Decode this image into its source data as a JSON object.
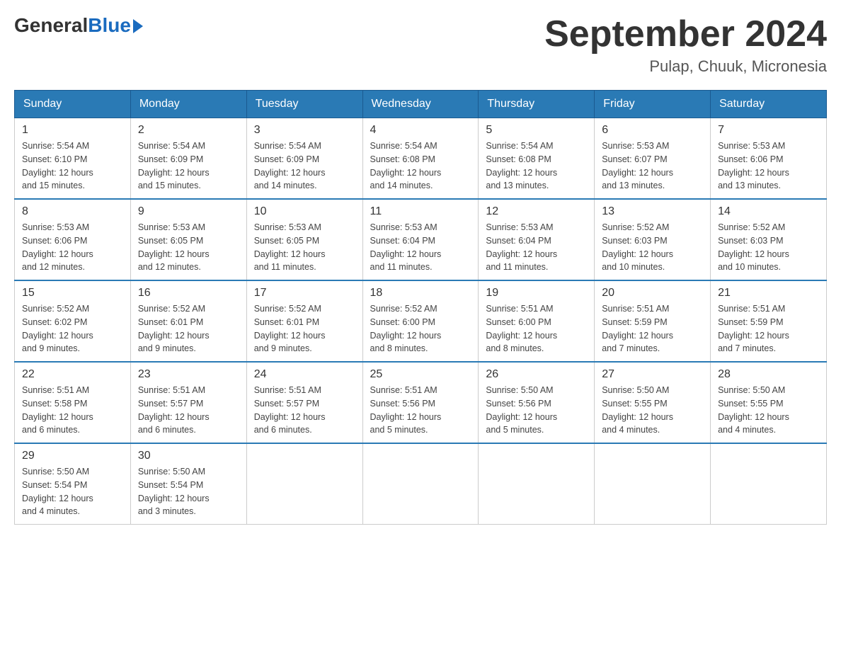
{
  "header": {
    "logo_general": "General",
    "logo_blue": "Blue",
    "month_title": "September 2024",
    "location": "Pulap, Chuuk, Micronesia"
  },
  "weekdays": [
    "Sunday",
    "Monday",
    "Tuesday",
    "Wednesday",
    "Thursday",
    "Friday",
    "Saturday"
  ],
  "weeks": [
    [
      {
        "day": "1",
        "sunrise": "5:54 AM",
        "sunset": "6:10 PM",
        "daylight": "12 hours and 15 minutes."
      },
      {
        "day": "2",
        "sunrise": "5:54 AM",
        "sunset": "6:09 PM",
        "daylight": "12 hours and 15 minutes."
      },
      {
        "day": "3",
        "sunrise": "5:54 AM",
        "sunset": "6:09 PM",
        "daylight": "12 hours and 14 minutes."
      },
      {
        "day": "4",
        "sunrise": "5:54 AM",
        "sunset": "6:08 PM",
        "daylight": "12 hours and 14 minutes."
      },
      {
        "day": "5",
        "sunrise": "5:54 AM",
        "sunset": "6:08 PM",
        "daylight": "12 hours and 13 minutes."
      },
      {
        "day": "6",
        "sunrise": "5:53 AM",
        "sunset": "6:07 PM",
        "daylight": "12 hours and 13 minutes."
      },
      {
        "day": "7",
        "sunrise": "5:53 AM",
        "sunset": "6:06 PM",
        "daylight": "12 hours and 13 minutes."
      }
    ],
    [
      {
        "day": "8",
        "sunrise": "5:53 AM",
        "sunset": "6:06 PM",
        "daylight": "12 hours and 12 minutes."
      },
      {
        "day": "9",
        "sunrise": "5:53 AM",
        "sunset": "6:05 PM",
        "daylight": "12 hours and 12 minutes."
      },
      {
        "day": "10",
        "sunrise": "5:53 AM",
        "sunset": "6:05 PM",
        "daylight": "12 hours and 11 minutes."
      },
      {
        "day": "11",
        "sunrise": "5:53 AM",
        "sunset": "6:04 PM",
        "daylight": "12 hours and 11 minutes."
      },
      {
        "day": "12",
        "sunrise": "5:53 AM",
        "sunset": "6:04 PM",
        "daylight": "12 hours and 11 minutes."
      },
      {
        "day": "13",
        "sunrise": "5:52 AM",
        "sunset": "6:03 PM",
        "daylight": "12 hours and 10 minutes."
      },
      {
        "day": "14",
        "sunrise": "5:52 AM",
        "sunset": "6:03 PM",
        "daylight": "12 hours and 10 minutes."
      }
    ],
    [
      {
        "day": "15",
        "sunrise": "5:52 AM",
        "sunset": "6:02 PM",
        "daylight": "12 hours and 9 minutes."
      },
      {
        "day": "16",
        "sunrise": "5:52 AM",
        "sunset": "6:01 PM",
        "daylight": "12 hours and 9 minutes."
      },
      {
        "day": "17",
        "sunrise": "5:52 AM",
        "sunset": "6:01 PM",
        "daylight": "12 hours and 9 minutes."
      },
      {
        "day": "18",
        "sunrise": "5:52 AM",
        "sunset": "6:00 PM",
        "daylight": "12 hours and 8 minutes."
      },
      {
        "day": "19",
        "sunrise": "5:51 AM",
        "sunset": "6:00 PM",
        "daylight": "12 hours and 8 minutes."
      },
      {
        "day": "20",
        "sunrise": "5:51 AM",
        "sunset": "5:59 PM",
        "daylight": "12 hours and 7 minutes."
      },
      {
        "day": "21",
        "sunrise": "5:51 AM",
        "sunset": "5:59 PM",
        "daylight": "12 hours and 7 minutes."
      }
    ],
    [
      {
        "day": "22",
        "sunrise": "5:51 AM",
        "sunset": "5:58 PM",
        "daylight": "12 hours and 6 minutes."
      },
      {
        "day": "23",
        "sunrise": "5:51 AM",
        "sunset": "5:57 PM",
        "daylight": "12 hours and 6 minutes."
      },
      {
        "day": "24",
        "sunrise": "5:51 AM",
        "sunset": "5:57 PM",
        "daylight": "12 hours and 6 minutes."
      },
      {
        "day": "25",
        "sunrise": "5:51 AM",
        "sunset": "5:56 PM",
        "daylight": "12 hours and 5 minutes."
      },
      {
        "day": "26",
        "sunrise": "5:50 AM",
        "sunset": "5:56 PM",
        "daylight": "12 hours and 5 minutes."
      },
      {
        "day": "27",
        "sunrise": "5:50 AM",
        "sunset": "5:55 PM",
        "daylight": "12 hours and 4 minutes."
      },
      {
        "day": "28",
        "sunrise": "5:50 AM",
        "sunset": "5:55 PM",
        "daylight": "12 hours and 4 minutes."
      }
    ],
    [
      {
        "day": "29",
        "sunrise": "5:50 AM",
        "sunset": "5:54 PM",
        "daylight": "12 hours and 4 minutes."
      },
      {
        "day": "30",
        "sunrise": "5:50 AM",
        "sunset": "5:54 PM",
        "daylight": "12 hours and 3 minutes."
      },
      null,
      null,
      null,
      null,
      null
    ]
  ]
}
